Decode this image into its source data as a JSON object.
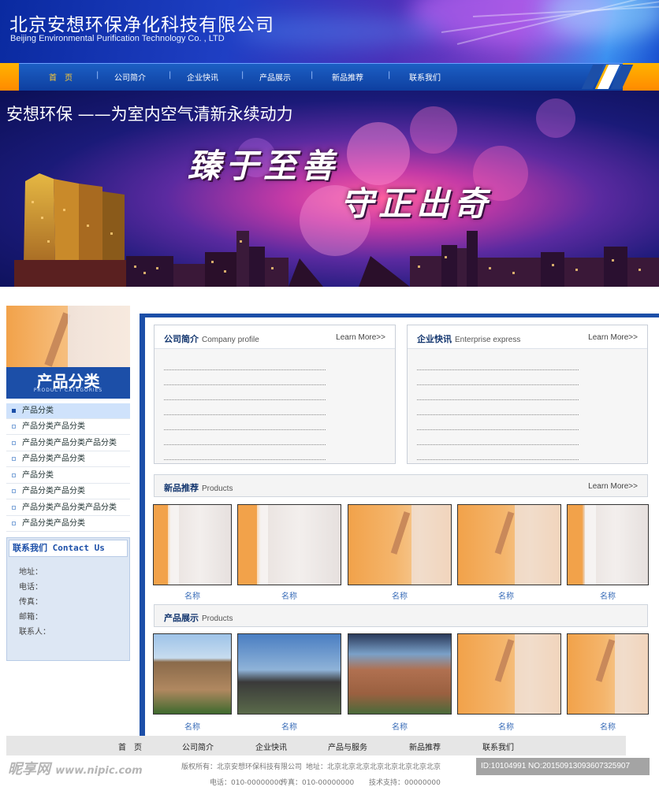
{
  "header": {
    "title": "北京安想环保净化科技有限公司",
    "subtitle": "Beijing Environmental Purification Technology Co. , LTD"
  },
  "nav": {
    "items": [
      "首　页",
      "公司简介",
      "企业快讯",
      "产品展示",
      "新品推荐",
      "联系我们"
    ],
    "active_index": 0
  },
  "banner": {
    "slogan": "安想环保 ——为室内空气清新永续动力",
    "calligraphy_1": "臻于至善",
    "calligraphy_2": "守正出奇"
  },
  "sidebar": {
    "category_title": "产品分类",
    "category_subtitle": "PRODUCT CATEGORIES",
    "categories": [
      "产品分类",
      "产品分类产品分类",
      "产品分类产品分类产品分类",
      "产品分类产品分类",
      "产品分类",
      "产品分类产品分类",
      "产品分类产品分类产品分类",
      "产品分类产品分类"
    ],
    "contact_title": "联系我们 Contact Us",
    "contact_lines": [
      "地址：",
      "电话：",
      "传真：",
      "邮箱：",
      "联系人："
    ]
  },
  "main": {
    "company_profile": {
      "title": "公司简介",
      "title_en": "Company profile",
      "more": "Learn More>>"
    },
    "enterprise_express": {
      "title": "企业快讯",
      "title_en": "Enterprise express",
      "more": "Learn More>>"
    },
    "new_products": {
      "title": "新品推荐",
      "title_en": "Products",
      "more": "Learn More>>",
      "items": [
        "名称",
        "名称",
        "名称",
        "名称",
        "名称"
      ]
    },
    "product_display": {
      "title": "产品展示",
      "title_en": "Products",
      "items": [
        "名称",
        "名称",
        "名称",
        "名称",
        "名称"
      ]
    }
  },
  "footer": {
    "nav": [
      "首　页",
      "公司简介",
      "企业快讯",
      "产品与服务",
      "新品推荐",
      "联系我们"
    ],
    "copyright": "版权所有：北京安想环保科技有限公司",
    "address": "地址：北京北京北京北京北京北京北京北京",
    "phone": "电话：010-00000000",
    "fax": "传真：010-00000000",
    "support": "技术支持：00000000"
  },
  "watermark": {
    "site": "昵享网",
    "url": "www.nipic.com",
    "id": "ID:10104991 NO:20150913093607325907"
  },
  "colors": {
    "brand_blue": "#1c4fa8",
    "accent_orange": "#ff9a00",
    "nav_active": "#ffcc33"
  }
}
